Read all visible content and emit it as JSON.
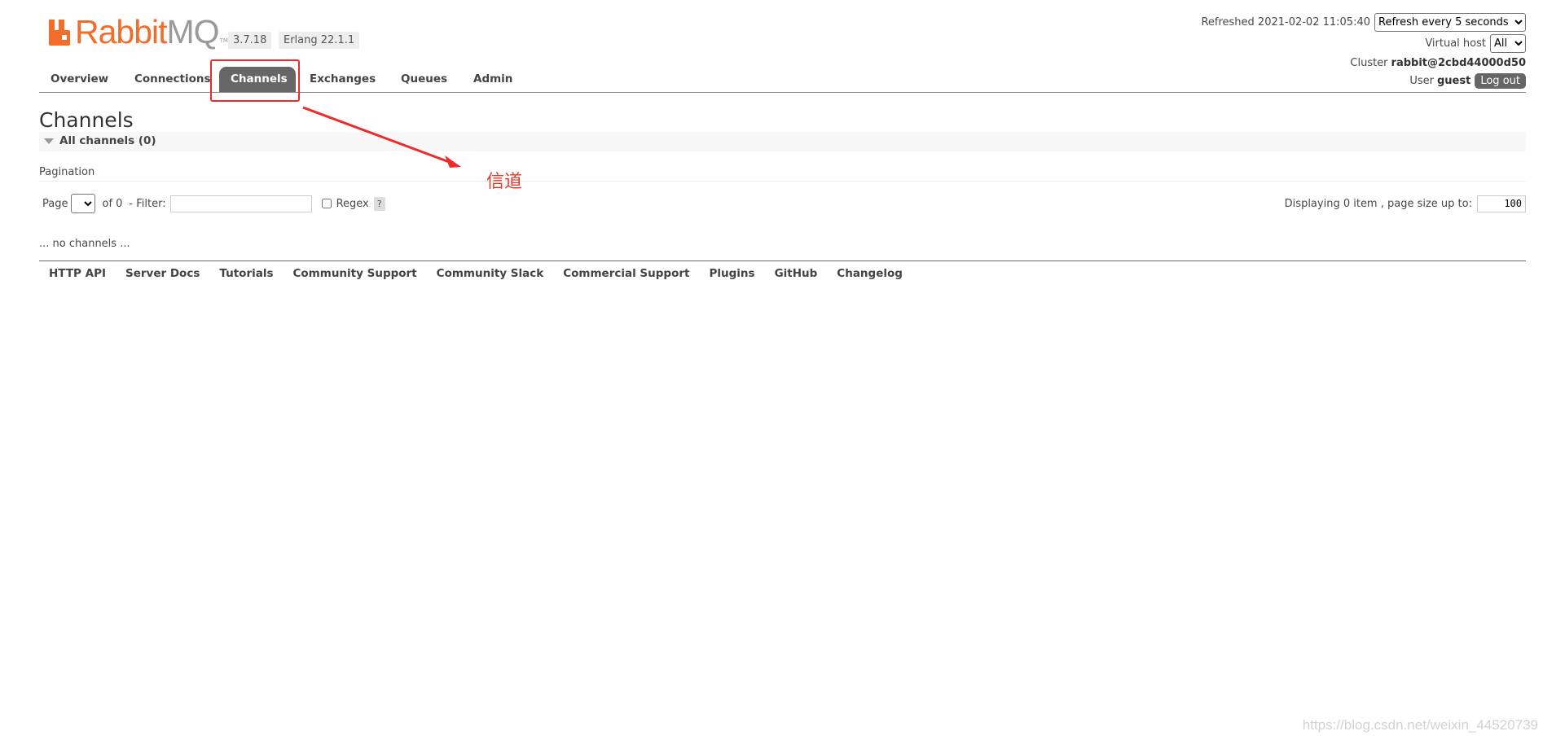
{
  "header": {
    "logo": {
      "brand_primary": "Rabbit",
      "brand_secondary": "MQ",
      "tm": "TM",
      "primary_color": "#f26c2a",
      "secondary_color": "#9a9a9a"
    },
    "version": "3.7.18",
    "erlang": "Erlang 22.1.1",
    "refreshed_label": "Refreshed 2021-02-02 11:05:40",
    "refresh_selected": "Refresh every 5 seconds",
    "virtual_host_label": "Virtual host",
    "virtual_host_selected": "All",
    "cluster_label": "Cluster",
    "cluster_name": "rabbit@2cbd44000d50",
    "user_label": "User",
    "user_name": "guest",
    "logout_label": "Log out"
  },
  "nav": {
    "tabs": [
      {
        "label": "Overview"
      },
      {
        "label": "Connections"
      },
      {
        "label": "Channels",
        "active": true
      },
      {
        "label": "Exchanges"
      },
      {
        "label": "Queues"
      },
      {
        "label": "Admin"
      }
    ],
    "active_color": "#666666"
  },
  "main": {
    "title": "Channels",
    "section_title": "All channels (0)",
    "pagination_label": "Pagination",
    "page_label": "Page",
    "of_label": "of 0",
    "filter_label": "- Filter:",
    "filter_value": "",
    "regex_label": "Regex",
    "regex_help": "?",
    "displaying_label": "Displaying 0 item , page size up to:",
    "page_size": "100",
    "empty_text": "... no channels ..."
  },
  "footer": {
    "links": [
      "HTTP API",
      "Server Docs",
      "Tutorials",
      "Community Support",
      "Community Slack",
      "Commercial Support",
      "Plugins",
      "GitHub",
      "Changelog"
    ]
  },
  "annotation": {
    "text": "信道",
    "color": "#e23b2b"
  },
  "watermark": "https://blog.csdn.net/weixin_44520739"
}
